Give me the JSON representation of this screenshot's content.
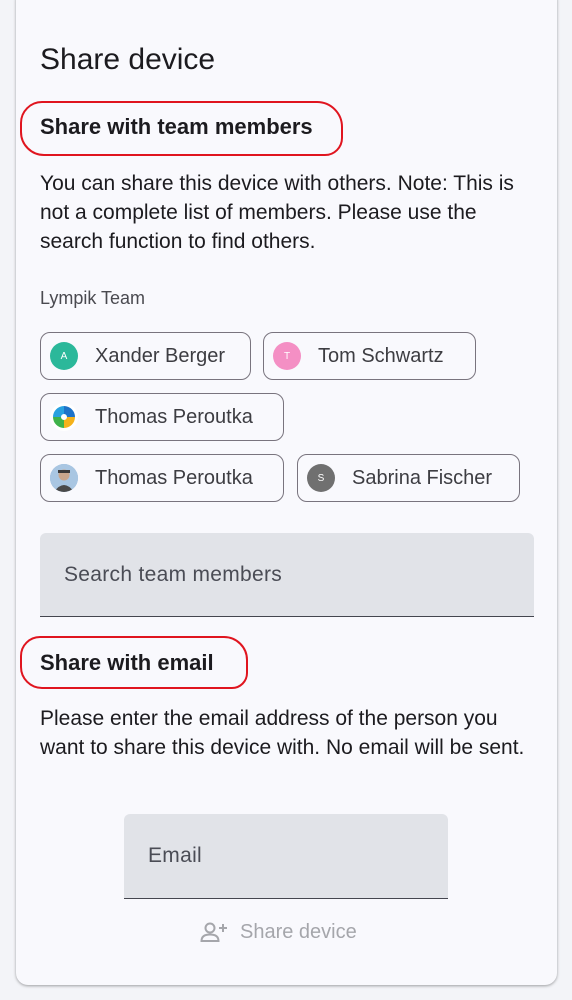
{
  "dialog": {
    "title": "Share device",
    "team_section": {
      "heading": "Share with team members",
      "description": "You can share this device with others. Note: This is not a complete list of members. Please use the search function to find others.",
      "team_name": "Lympik Team",
      "members": [
        {
          "name": "Xander Berger",
          "initial": "A",
          "avatar_color": "#2bb89a",
          "avatar_type": "letter"
        },
        {
          "name": "Tom Schwartz",
          "initial": "T",
          "avatar_color": "#f48fc4",
          "avatar_type": "letter"
        },
        {
          "name": "Thomas Peroutka",
          "initial": "",
          "avatar_color": "#ffffff",
          "avatar_type": "logo"
        },
        {
          "name": "Thomas Peroutka",
          "initial": "",
          "avatar_color": "#8fb3d8",
          "avatar_type": "photo"
        },
        {
          "name": "Sabrina Fischer",
          "initial": "S",
          "avatar_color": "#707070",
          "avatar_type": "letter"
        }
      ],
      "search_placeholder": "Search team members"
    },
    "email_section": {
      "heading": "Share with email",
      "description": "Please enter the email address of the person you want to share this device with. No email will be sent.",
      "email_placeholder": "Email"
    },
    "share_button_label": "Share device",
    "highlight_color": "#e0151f"
  }
}
